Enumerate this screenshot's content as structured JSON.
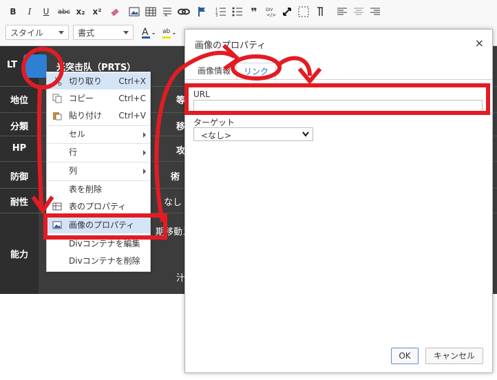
{
  "toolbar": {
    "buttons": [
      "B",
      "I",
      "U",
      "abc",
      "x₂",
      "x²"
    ],
    "style_combo": "スタイル",
    "format_combo": "書式"
  },
  "table": {
    "prefix": "LT",
    "name": "光突击队（PRTS）",
    "rows": [
      "地位",
      "分類",
      "HP",
      "防御",
      "耐性",
      "能力"
    ],
    "right_fragments": {
      "r1": "等",
      "r2": "移",
      "r3": "攻",
      "r4": "術",
      "r5": "なし",
      "r6a": "期移動ス",
      "r6b": "汁"
    }
  },
  "context_menu": {
    "items": [
      {
        "label": "切り取り",
        "shortcut": "Ctrl+X"
      },
      {
        "label": "コピー",
        "shortcut": "Ctrl+C"
      },
      {
        "label": "貼り付け",
        "shortcut": "Ctrl+V"
      },
      {
        "label": "セル"
      },
      {
        "label": "行"
      },
      {
        "label": "列"
      },
      {
        "label": "表を削除"
      },
      {
        "label": "表のプロパティ"
      },
      {
        "label": "画像のプロパティ"
      },
      {
        "label": "Divコンテナを編集"
      },
      {
        "label": "Divコンテナを削除"
      }
    ]
  },
  "dialog": {
    "title": "画像のプロパティ",
    "close": "×",
    "tabs": [
      "画像情報",
      "リンク"
    ],
    "url_label": "URL",
    "url_value": "",
    "target_label": "ターゲット",
    "target_value": "<なし>",
    "ok": "OK",
    "cancel": "キャンセル"
  },
  "colors": {
    "annotation": "#e31b23",
    "table_bg": "#3c3c3c",
    "menu_highlight": "#d4e4f7"
  }
}
